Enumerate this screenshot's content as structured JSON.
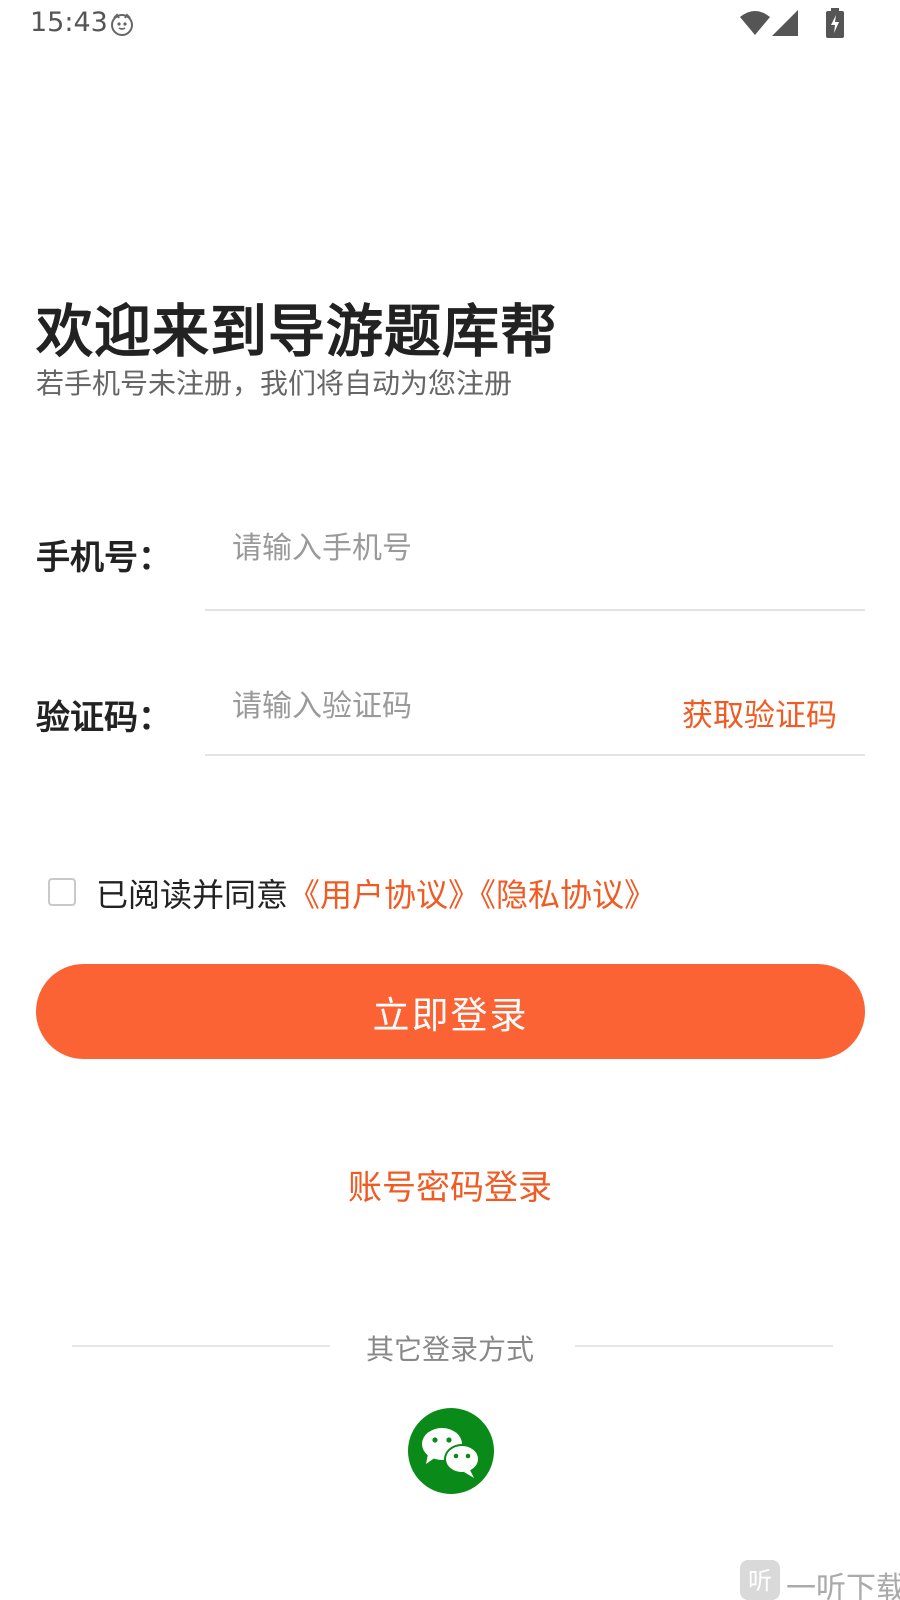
{
  "status_bar": {
    "time": "15:43",
    "icons": [
      "cat-face-icon",
      "wifi-icon",
      "signal-icon",
      "battery-charging-icon"
    ]
  },
  "header": {
    "title": "欢迎来到导游题库帮",
    "subtitle": "若手机号未注册，我们将自动为您注册"
  },
  "form": {
    "phone": {
      "label": "手机号：",
      "placeholder": "请输入手机号",
      "value": ""
    },
    "code": {
      "label": "验证码：",
      "placeholder": "请输入验证码",
      "value": "",
      "get_code_label": "获取验证码"
    }
  },
  "agreement": {
    "checked": false,
    "prefix": "已阅读并同意",
    "user_agreement": "《用户协议》",
    "privacy_policy": "《隐私协议》"
  },
  "login_button": "立即登录",
  "account_login": "账号密码登录",
  "other_login": {
    "label": "其它登录方式",
    "methods": [
      "wechat-icon"
    ]
  },
  "watermark": "一听下载",
  "colors": {
    "accent": "#f15a22",
    "button": "#fc6334",
    "wechat": "#0a8a18"
  }
}
